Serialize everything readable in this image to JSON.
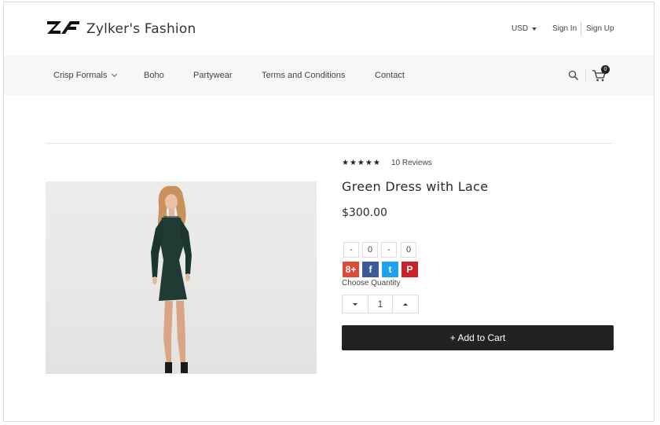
{
  "header": {
    "brand": "Zylker's Fashion",
    "currency": "USD",
    "sign_in": "Sign In",
    "sign_up": "Sign Up"
  },
  "nav": {
    "items": [
      {
        "label": "Crisp Formals",
        "has_dropdown": true
      },
      {
        "label": "Boho"
      },
      {
        "label": "Partywear"
      },
      {
        "label": "Terms and Conditions"
      },
      {
        "label": "Contact"
      }
    ],
    "cart_count": "0"
  },
  "product": {
    "stars": "★★★★★",
    "rating": 5,
    "reviews": "10 Reviews",
    "title": "Green Dress with Lace",
    "price": "$300.00",
    "share_counts": [
      "-",
      "0",
      "-",
      "0"
    ],
    "social": [
      {
        "name": "google-plus",
        "glyph": "8+",
        "color": "#dd4b39"
      },
      {
        "name": "facebook",
        "glyph": "f",
        "color": "#3b5998"
      },
      {
        "name": "twitter",
        "glyph": "t",
        "color": "#1da1f2"
      },
      {
        "name": "pinterest",
        "glyph": "P",
        "color": "#cb2027"
      }
    ],
    "quantity_label": "Choose Quantity",
    "quantity": "1",
    "add_to_cart": "+ Add to Cart",
    "image": {
      "subject": "woman in green dress",
      "dress_color": "#1f3b33"
    }
  },
  "colors": {
    "nav_bg": "#f7f7f7",
    "button_bg": "#222222",
    "text": "#333333"
  }
}
